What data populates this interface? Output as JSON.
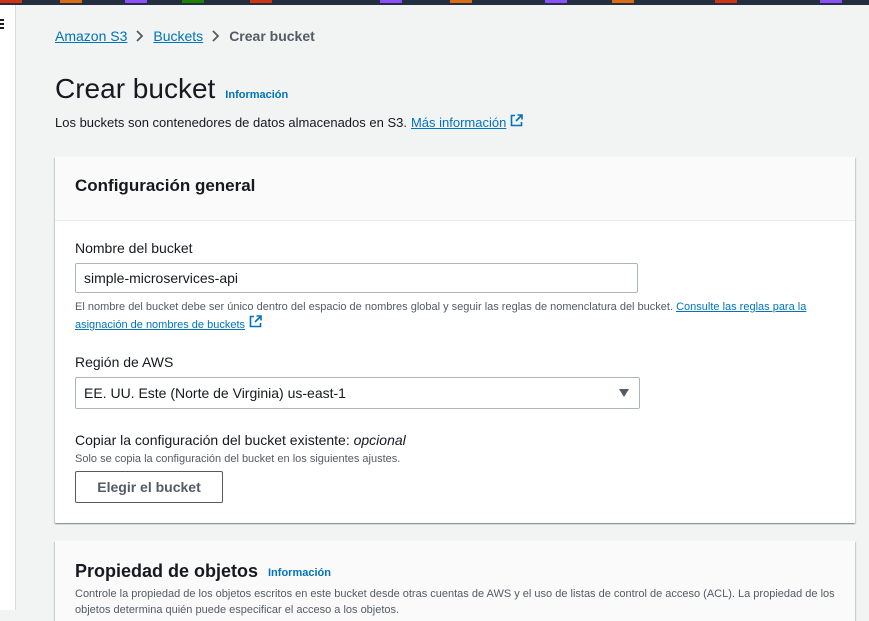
{
  "breadcrumb": {
    "items": [
      "Amazon S3",
      "Buckets"
    ],
    "current": "Crear bucket"
  },
  "header": {
    "title": "Crear bucket",
    "info_label": "Información",
    "subtitle": "Los buckets son contenedores de datos almacenados en S3.",
    "more_info_link": "Más información"
  },
  "general_config": {
    "title": "Configuración general",
    "bucket_name_label": "Nombre del bucket",
    "bucket_name_value": "simple-microservices-api",
    "bucket_name_hint": "El nombre del bucket debe ser único dentro del espacio de nombres global y seguir las reglas de nomenclatura del bucket.",
    "bucket_name_hint_link": "Consulte las reglas para la asignación de nombres de buckets",
    "region_label": "Región de AWS",
    "region_value": "EE. UU. Este (Norte de Virginia) us-east-1",
    "copy_label": "Copiar la configuración del bucket existente:",
    "copy_optional": "opcional",
    "copy_hint": "Solo se copia la configuración del bucket en los siguientes ajustes.",
    "choose_bucket_button": "Elegir el bucket"
  },
  "object_ownership": {
    "title": "Propiedad de objetos",
    "info_label": "Información",
    "description": "Controle la propiedad de los objetos escritos en este bucket desde otras cuentas de AWS y el uso de listas de control de acceso (ACL). La propiedad de los objetos determina quién puede especificar el acceso a los objetos."
  },
  "colors": {
    "link": "#0073bb",
    "top_bar": "#232f3e",
    "background": "#f2f3f3"
  }
}
